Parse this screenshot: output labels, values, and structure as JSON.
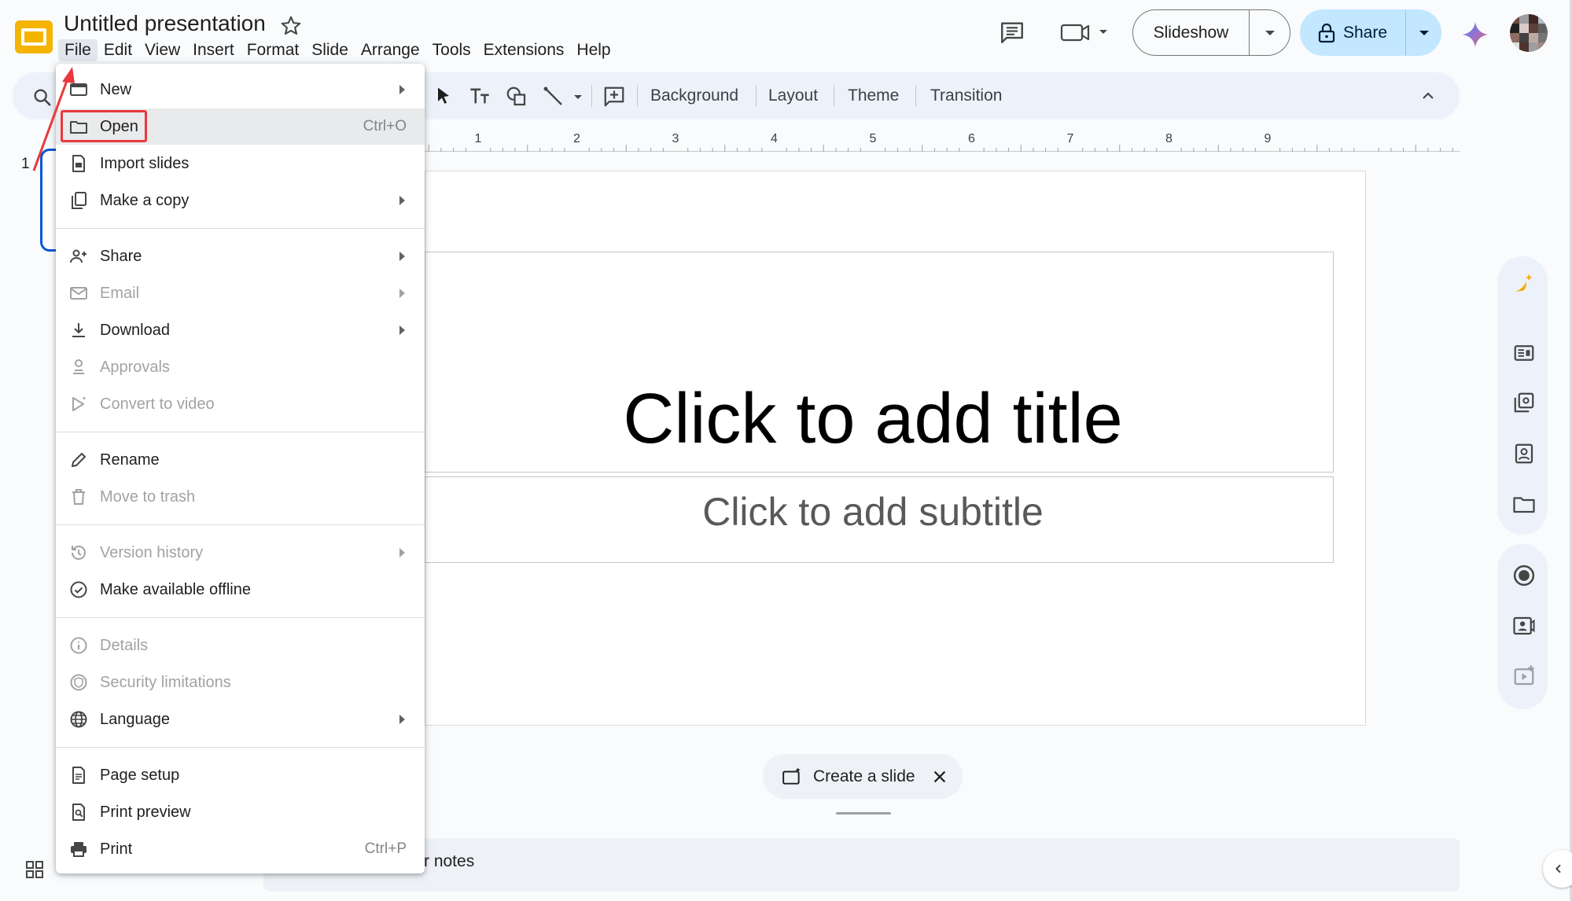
{
  "header": {
    "doc_title": "Untitled presentation",
    "menus": [
      "File",
      "Edit",
      "View",
      "Insert",
      "Format",
      "Slide",
      "Arrange",
      "Tools",
      "Extensions",
      "Help"
    ],
    "slideshow_label": "Slideshow",
    "share_label": "Share"
  },
  "toolbar": {
    "background_label": "Background",
    "layout_label": "Layout",
    "theme_label": "Theme",
    "transition_label": "Transition"
  },
  "ruler": {
    "ticks": [
      "1",
      "2",
      "3",
      "4",
      "5",
      "6",
      "7",
      "8",
      "9"
    ]
  },
  "slides_panel": {
    "slide_number": "1"
  },
  "slide": {
    "title_placeholder": "Click to add title",
    "subtitle_placeholder": "Click to add subtitle"
  },
  "create_slide": {
    "label": "Create a slide"
  },
  "notes": {
    "visible_text": "r notes"
  },
  "file_menu": {
    "items": {
      "new": {
        "label": "New",
        "submenu": true,
        "disabled": false,
        "icon": "new-presentation-icon"
      },
      "open": {
        "label": "Open",
        "shortcut": "Ctrl+O",
        "disabled": false,
        "icon": "folder-icon"
      },
      "import_slides": {
        "label": "Import slides",
        "disabled": false,
        "icon": "import-slides-icon"
      },
      "make_copy": {
        "label": "Make a copy",
        "submenu": true,
        "disabled": false,
        "icon": "copy-icon"
      },
      "share": {
        "label": "Share",
        "submenu": true,
        "disabled": false,
        "icon": "person-add-icon"
      },
      "email": {
        "label": "Email",
        "submenu": true,
        "disabled": true,
        "icon": "mail-icon"
      },
      "download": {
        "label": "Download",
        "submenu": true,
        "disabled": false,
        "icon": "download-icon"
      },
      "approvals": {
        "label": "Approvals",
        "disabled": true,
        "icon": "approvals-icon"
      },
      "convert_video": {
        "label": "Convert to video",
        "disabled": true,
        "icon": "video-convert-icon"
      },
      "rename": {
        "label": "Rename",
        "disabled": false,
        "icon": "pencil-icon"
      },
      "move_trash": {
        "label": "Move to trash",
        "disabled": true,
        "icon": "trash-icon"
      },
      "version_history": {
        "label": "Version history",
        "submenu": true,
        "disabled": true,
        "icon": "history-icon"
      },
      "offline": {
        "label": "Make available offline",
        "disabled": false,
        "icon": "offline-check-icon"
      },
      "details": {
        "label": "Details",
        "disabled": true,
        "icon": "info-icon"
      },
      "security": {
        "label": "Security limitations",
        "disabled": true,
        "icon": "security-icon"
      },
      "language": {
        "label": "Language",
        "submenu": true,
        "disabled": false,
        "icon": "globe-icon"
      },
      "page_setup": {
        "label": "Page setup",
        "disabled": false,
        "icon": "page-icon"
      },
      "print_preview": {
        "label": "Print preview",
        "disabled": false,
        "icon": "print-preview-icon"
      },
      "print": {
        "label": "Print",
        "shortcut": "Ctrl+P",
        "disabled": false,
        "icon": "printer-icon"
      }
    }
  },
  "colors": {
    "accent": "#0b57d0",
    "share_button": "#c2e7ff",
    "annotation": "#e8383d",
    "app_logo": "#f4b400"
  }
}
